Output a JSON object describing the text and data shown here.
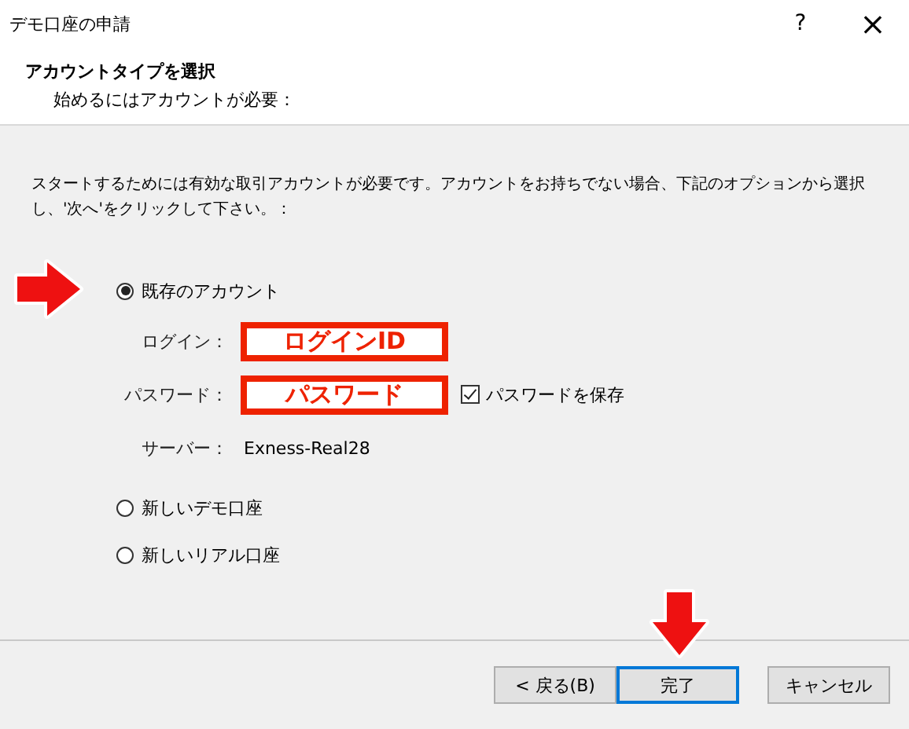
{
  "window": {
    "title": "デモ口座の申請",
    "help": "?",
    "close": "×"
  },
  "header": {
    "title": "アカウントタイプを選択",
    "subtitle": "始めるにはアカウントが必要："
  },
  "intro": "スタートするためには有効な取引アカウントが必要です。アカウントをお持ちでない場合、下記のオプションから選択し、'次へ'をクリックして下さい。：",
  "options": [
    {
      "label": "既存のアカウント",
      "selected": true
    },
    {
      "label": "新しいデモ口座",
      "selected": false
    },
    {
      "label": "新しいリアル口座",
      "selected": false
    }
  ],
  "login": {
    "label": "ログイン：",
    "value": "ログインID"
  },
  "password": {
    "label": "パスワード：",
    "value": "パスワード",
    "save_label": "パスワードを保存",
    "save_checked": true
  },
  "server": {
    "label": "サーバー：",
    "value": "Exness-Real28"
  },
  "buttons": [
    {
      "label": "< 戻る(B)",
      "default": false
    },
    {
      "label": "完了",
      "default": true
    },
    {
      "label": "キャンセル",
      "default": false
    }
  ]
}
